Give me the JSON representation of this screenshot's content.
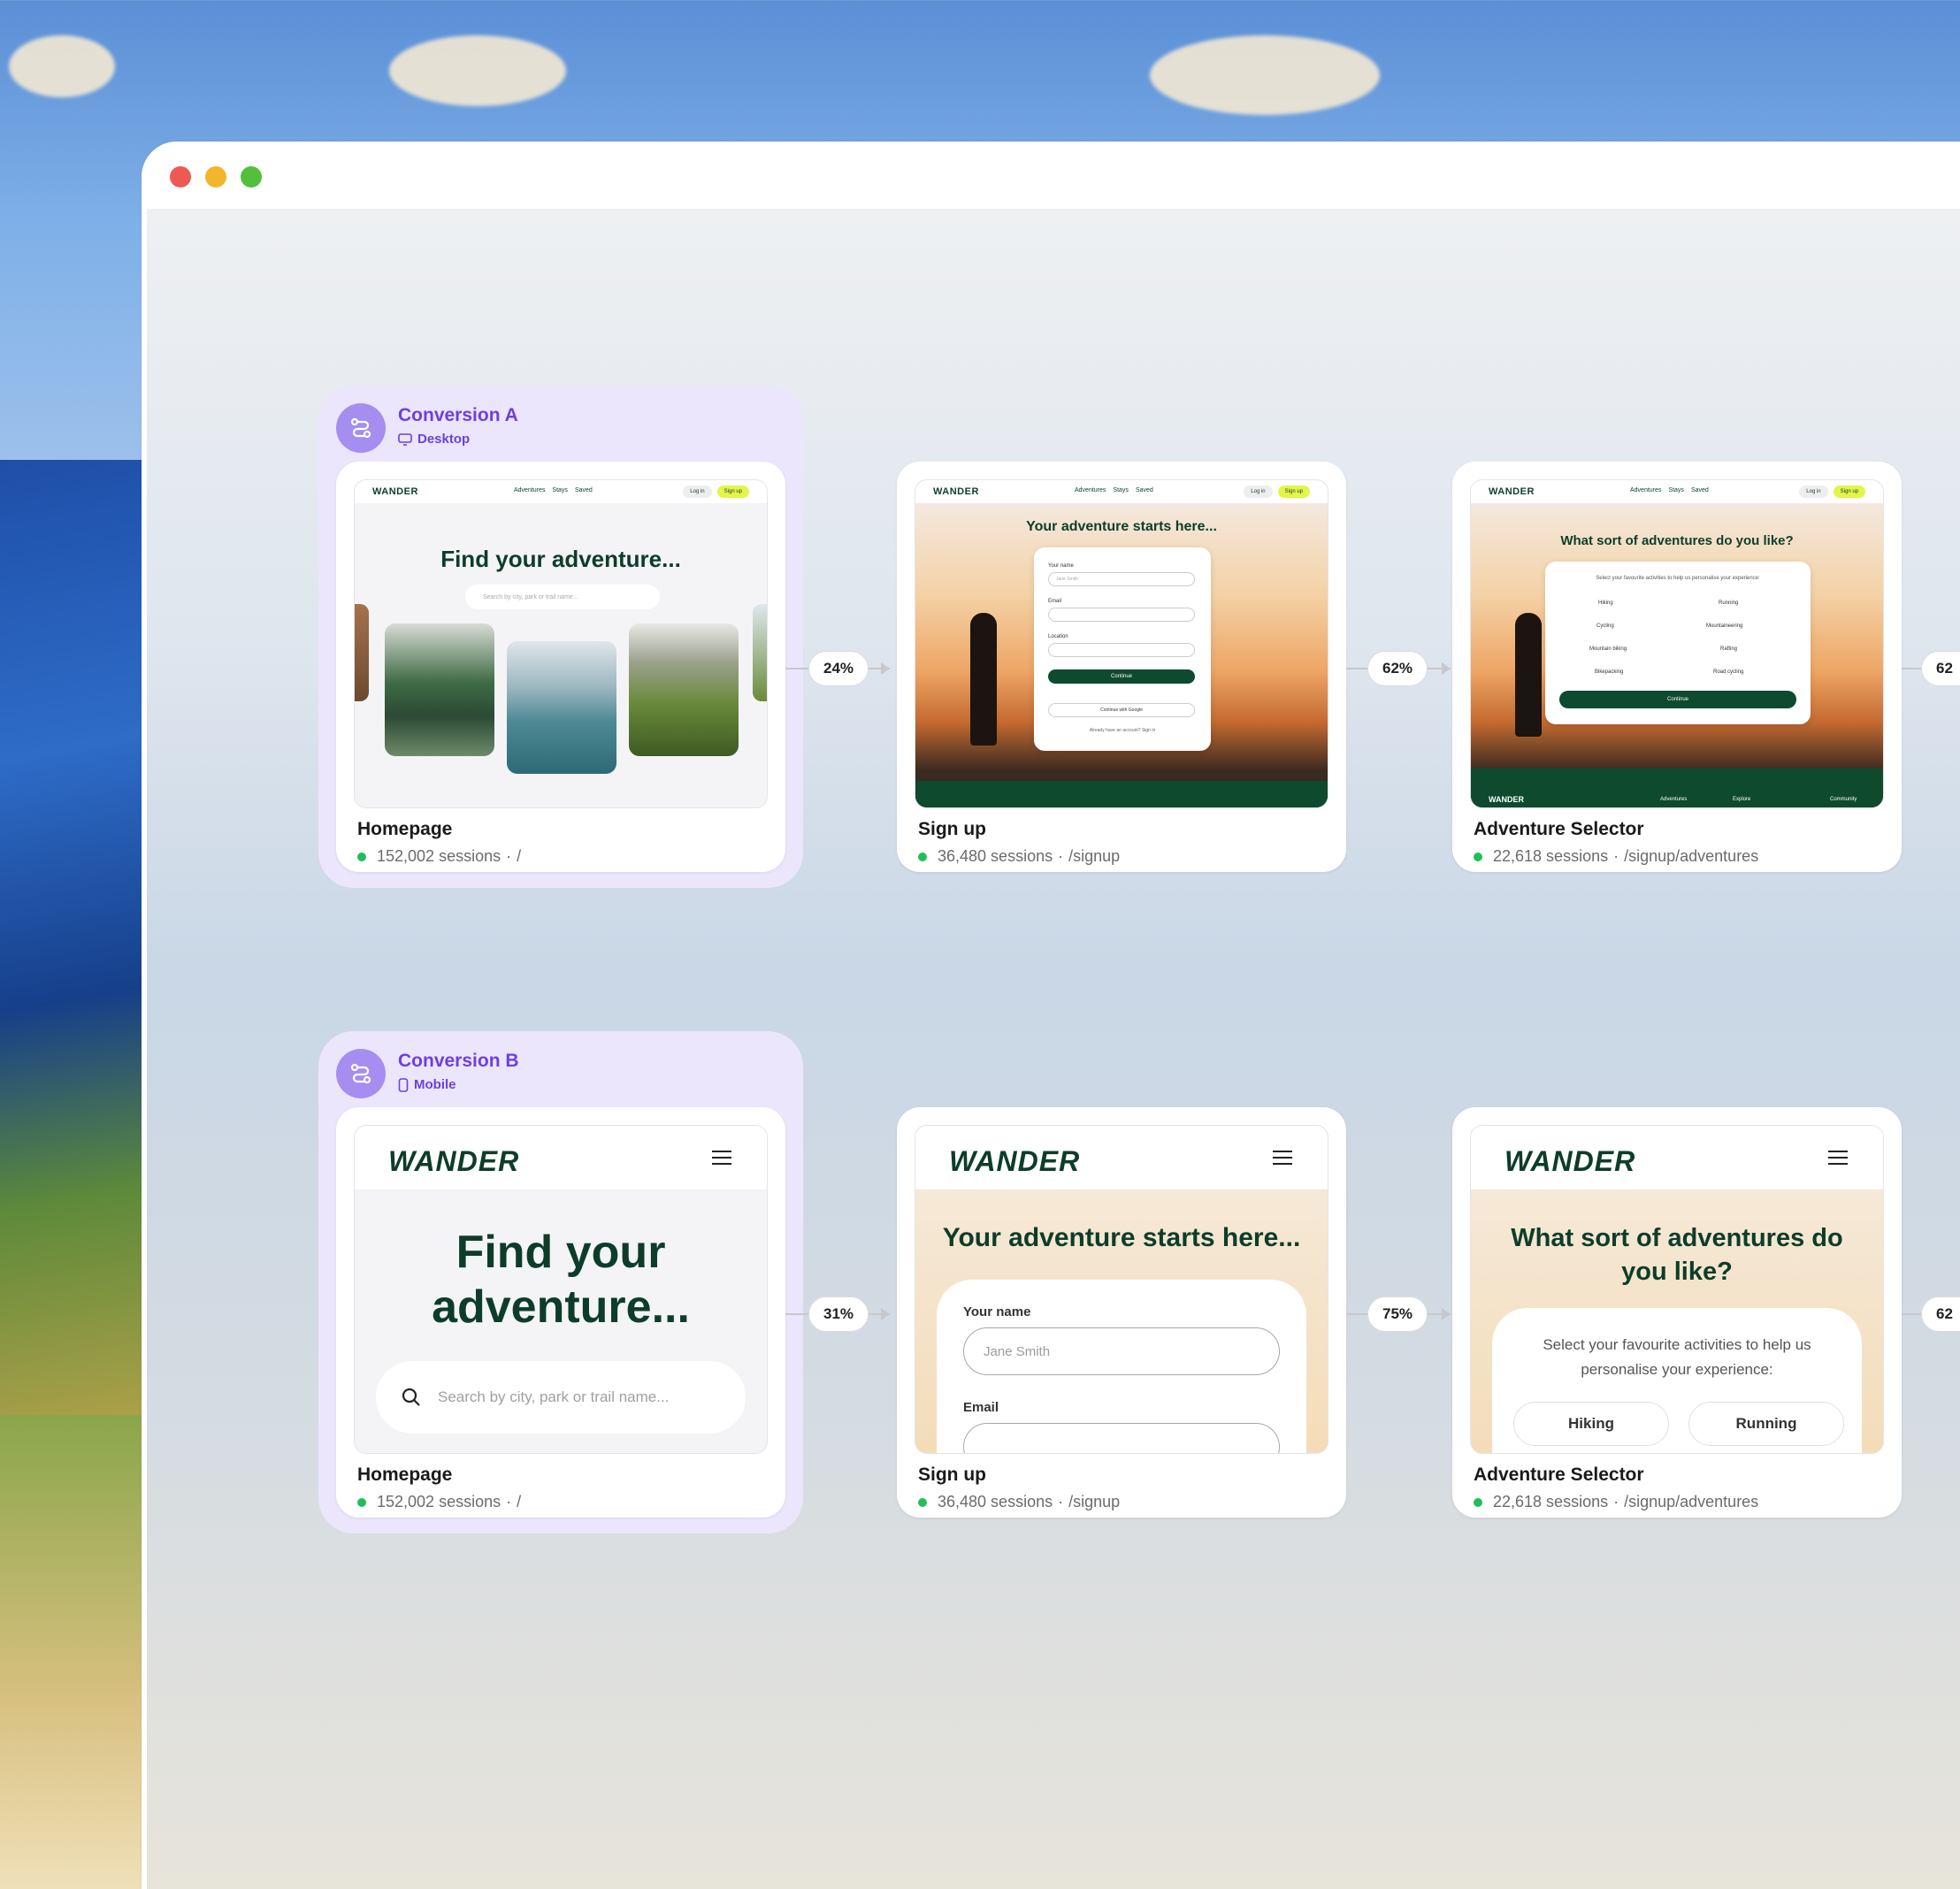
{
  "flows": [
    {
      "name": "Conversion A",
      "device": "Desktop",
      "steps": [
        {
          "title": "Homepage",
          "sessions": "152,002 sessions",
          "path": "/"
        },
        {
          "title": "Sign up",
          "sessions": "36,480 sessions",
          "path": "/signup"
        },
        {
          "title": "Adventure Selector",
          "sessions": "22,618 sessions",
          "path": "/signup/adventures"
        }
      ],
      "rates": [
        "24%",
        "62%",
        "62"
      ]
    },
    {
      "name": "Conversion B",
      "device": "Mobile",
      "steps": [
        {
          "title": "Homepage",
          "sessions": "152,002 sessions",
          "path": "/"
        },
        {
          "title": "Sign up",
          "sessions": "36,480 sessions",
          "path": "/signup"
        },
        {
          "title": "Adventure Selector",
          "sessions": "22,618 sessions",
          "path": "/signup/adventures"
        }
      ],
      "rates": [
        "31%",
        "75%",
        "62"
      ]
    }
  ],
  "site": {
    "logo": "WANDER",
    "nav": [
      "Adventures",
      "Stays",
      "Saved"
    ],
    "login": "Log in",
    "signup": "Sign up",
    "home_heading": "Find your adventure...",
    "home_heading_mobile_1": "Find your",
    "home_heading_mobile_2": "adventure...",
    "search_placeholder": "Search by city, park or trail name...",
    "signup_heading": "Your adventure starts here...",
    "your_name_label": "Your name",
    "your_name_placeholder": "Jane Smith",
    "email_label": "Email",
    "location_label": "Location",
    "continue": "Continue",
    "google": "Continue with Google",
    "have_account": "Already have an account? Sign in",
    "selector_heading": "What sort of adventures do you like?",
    "selector_heading_m1": "What sort of adventures do",
    "selector_heading_m2": "you like?",
    "selector_sub": "Select your favourite activities to help us personalise your experience:",
    "selector_sub_m1": "Select your favourite activities to help us",
    "selector_sub_m2": "personalise your experience:",
    "activities": [
      "Hiking",
      "Running",
      "Cycling",
      "Mountaineering",
      "Mountain biking",
      "Rafting",
      "Bikepacking",
      "Road cycling"
    ],
    "footer_links": [
      "Adventures",
      "Explore",
      "Community"
    ]
  },
  "colors": {
    "group_bg": "#ebe6fb",
    "group_accent": "#6d3fe0",
    "brand_green": "#0d3d2a",
    "status_green": "#1fbf5a",
    "signup_button": "#e4f54a"
  }
}
